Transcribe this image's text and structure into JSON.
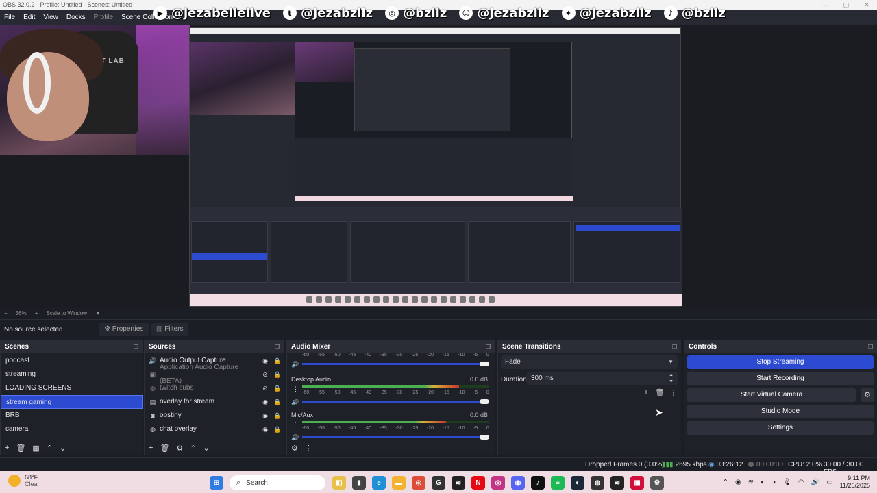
{
  "window": {
    "title": "OBS 32.0.2 - Profile: Untitled - Scenes: Untitled"
  },
  "menu": [
    "File",
    "Edit",
    "View",
    "Docks",
    "Profile",
    "Scene Collection"
  ],
  "social": [
    {
      "icon": "youtube-icon",
      "glyph": "▶",
      "handle": "@jezabellelive"
    },
    {
      "icon": "twitch-icon",
      "glyph": "t",
      "handle": "@jezabzllz"
    },
    {
      "icon": "instagram-icon",
      "glyph": "◎",
      "handle": "@bzllz"
    },
    {
      "icon": "snapchat-icon",
      "glyph": "☺",
      "handle": "@jezabzllz"
    },
    {
      "icon": "twitter-icon",
      "glyph": "✦",
      "handle": "@jezabzllz"
    },
    {
      "icon": "tiktok-icon",
      "glyph": "♪",
      "handle": "@bzllz"
    }
  ],
  "preview": {
    "webcam_chair_text": "SECRET LAB"
  },
  "zoom": {
    "minus": "−",
    "level": "56%",
    "plus": "+",
    "mode": "Scale to Window"
  },
  "selection": {
    "status": "No source selected",
    "properties": "Properties",
    "filters": "Filters"
  },
  "scenes": {
    "title": "Scenes",
    "items": [
      "podcast",
      "streaming",
      "LOADING SCREENS",
      "stream gaming",
      "BRB",
      "camera"
    ],
    "selected_index": 3
  },
  "sources": {
    "title": "Sources",
    "items": [
      {
        "label": "Audio Output Capture",
        "icon": "speaker-icon",
        "hidden": false
      },
      {
        "label": "Application Audio Capture (BETA)",
        "icon": "app-audio-icon",
        "hidden": true
      },
      {
        "label": "twitch subs",
        "icon": "browser-icon",
        "hidden": true
      },
      {
        "label": "overlay for stream",
        "icon": "image-icon",
        "hidden": false
      },
      {
        "label": "obstiny",
        "icon": "camera-icon",
        "hidden": false
      },
      {
        "label": "chat overlay",
        "icon": "browser-icon",
        "hidden": false
      }
    ]
  },
  "audio_mixer": {
    "title": "Audio Mixer",
    "ticks": [
      "-60",
      "-55",
      "-50",
      "-45",
      "-40",
      "-35",
      "-30",
      "-25",
      "-20",
      "-15",
      "-10",
      "-5",
      "0"
    ],
    "channels": [
      {
        "name": "",
        "db": "",
        "level": 0
      },
      {
        "name": "Desktop Audio",
        "db": "0.0 dB",
        "level": 0.84
      },
      {
        "name": "Mic/Aux",
        "db": "0.0 dB",
        "level": 0.77
      }
    ]
  },
  "transitions": {
    "title": "Scene Transitions",
    "selected": "Fade",
    "duration_label": "Duration",
    "duration": "300 ms"
  },
  "controls": {
    "title": "Controls",
    "buttons": [
      "Stop Streaming",
      "Start Recording",
      "Start Virtual Camera",
      "Studio Mode",
      "Settings"
    ]
  },
  "status": {
    "dropped": "Dropped Frames 0 (0.0%)",
    "kbps": "2695 kbps",
    "stream_time": "03:26:12",
    "rec_time": "00:00:00",
    "cpu": "CPU: 2.0%",
    "fps": "30.00 / 30.00 FPS"
  },
  "taskbar": {
    "weather_temp": "68°F",
    "weather_desc": "Clear",
    "search": "Search",
    "time": "9:11 PM",
    "date": "11/26/2025",
    "colors": {
      "accent": "#2c4bd0",
      "taskbar": "#f0dde3"
    }
  }
}
